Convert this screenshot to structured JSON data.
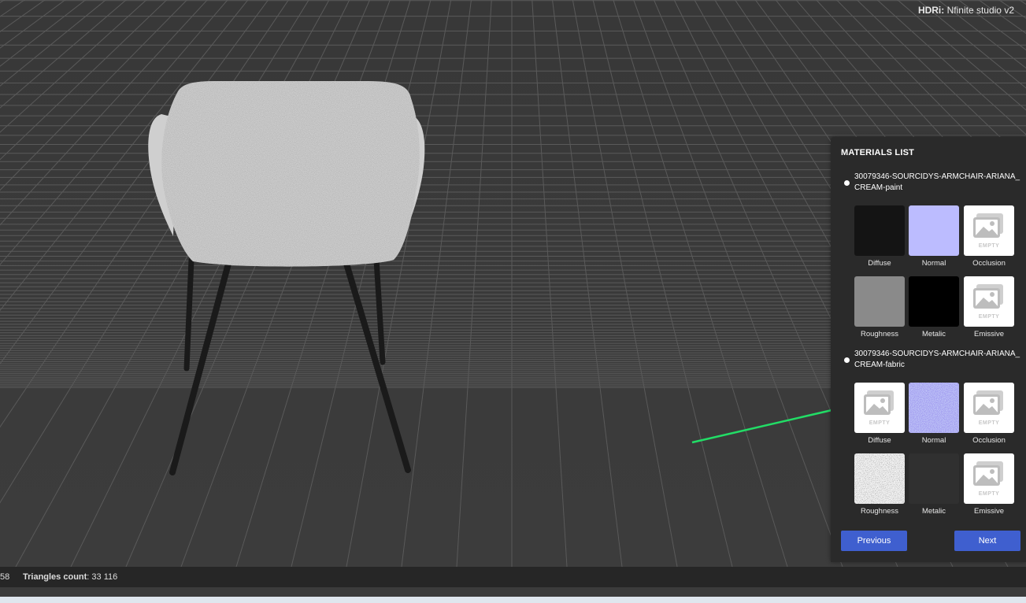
{
  "viewer": {
    "hdri_label": "HDRi:",
    "hdri_value": "Nfinite studio v2"
  },
  "materials": {
    "title": "MATERIALS LIST",
    "items": [
      {
        "name": "30079346-SOURCIDYS-ARMCHAIR-ARIANA_CREAM-paint",
        "textures": [
          {
            "label": "Diffuse",
            "kind": "solid",
            "color": "#141414"
          },
          {
            "label": "Normal",
            "kind": "solid",
            "color": "#bcbcff"
          },
          {
            "label": "Occlusion",
            "kind": "empty",
            "empty_text": "EMPTY"
          },
          {
            "label": "Roughness",
            "kind": "solid",
            "color": "#8a8a8a"
          },
          {
            "label": "Metalic",
            "kind": "solid",
            "color": "#000000"
          },
          {
            "label": "Emissive",
            "kind": "empty",
            "empty_text": "EMPTY"
          }
        ]
      },
      {
        "name": "30079346-SOURCIDYS-ARMCHAIR-ARIANA_CREAM-fabric",
        "textures": [
          {
            "label": "Diffuse",
            "kind": "empty",
            "empty_text": "EMPTY"
          },
          {
            "label": "Normal",
            "kind": "noise-normal",
            "color": "#9c94ee"
          },
          {
            "label": "Occlusion",
            "kind": "empty",
            "empty_text": "EMPTY"
          },
          {
            "label": "Roughness",
            "kind": "noise-rough",
            "color": "#f2f2f2"
          },
          {
            "label": "Metalic",
            "kind": "solid",
            "color": "#303030"
          },
          {
            "label": "Emissive",
            "kind": "empty",
            "empty_text": "EMPTY"
          }
        ]
      }
    ],
    "previous_label": "Previous",
    "next_label": "Next"
  },
  "status": {
    "left_number": "58",
    "triangles_label": "Triangles count",
    "triangles_value": ": 33 116"
  },
  "colors": {
    "accent_button": "#3f5fcf",
    "annotation_arrow": "#22dd66"
  }
}
